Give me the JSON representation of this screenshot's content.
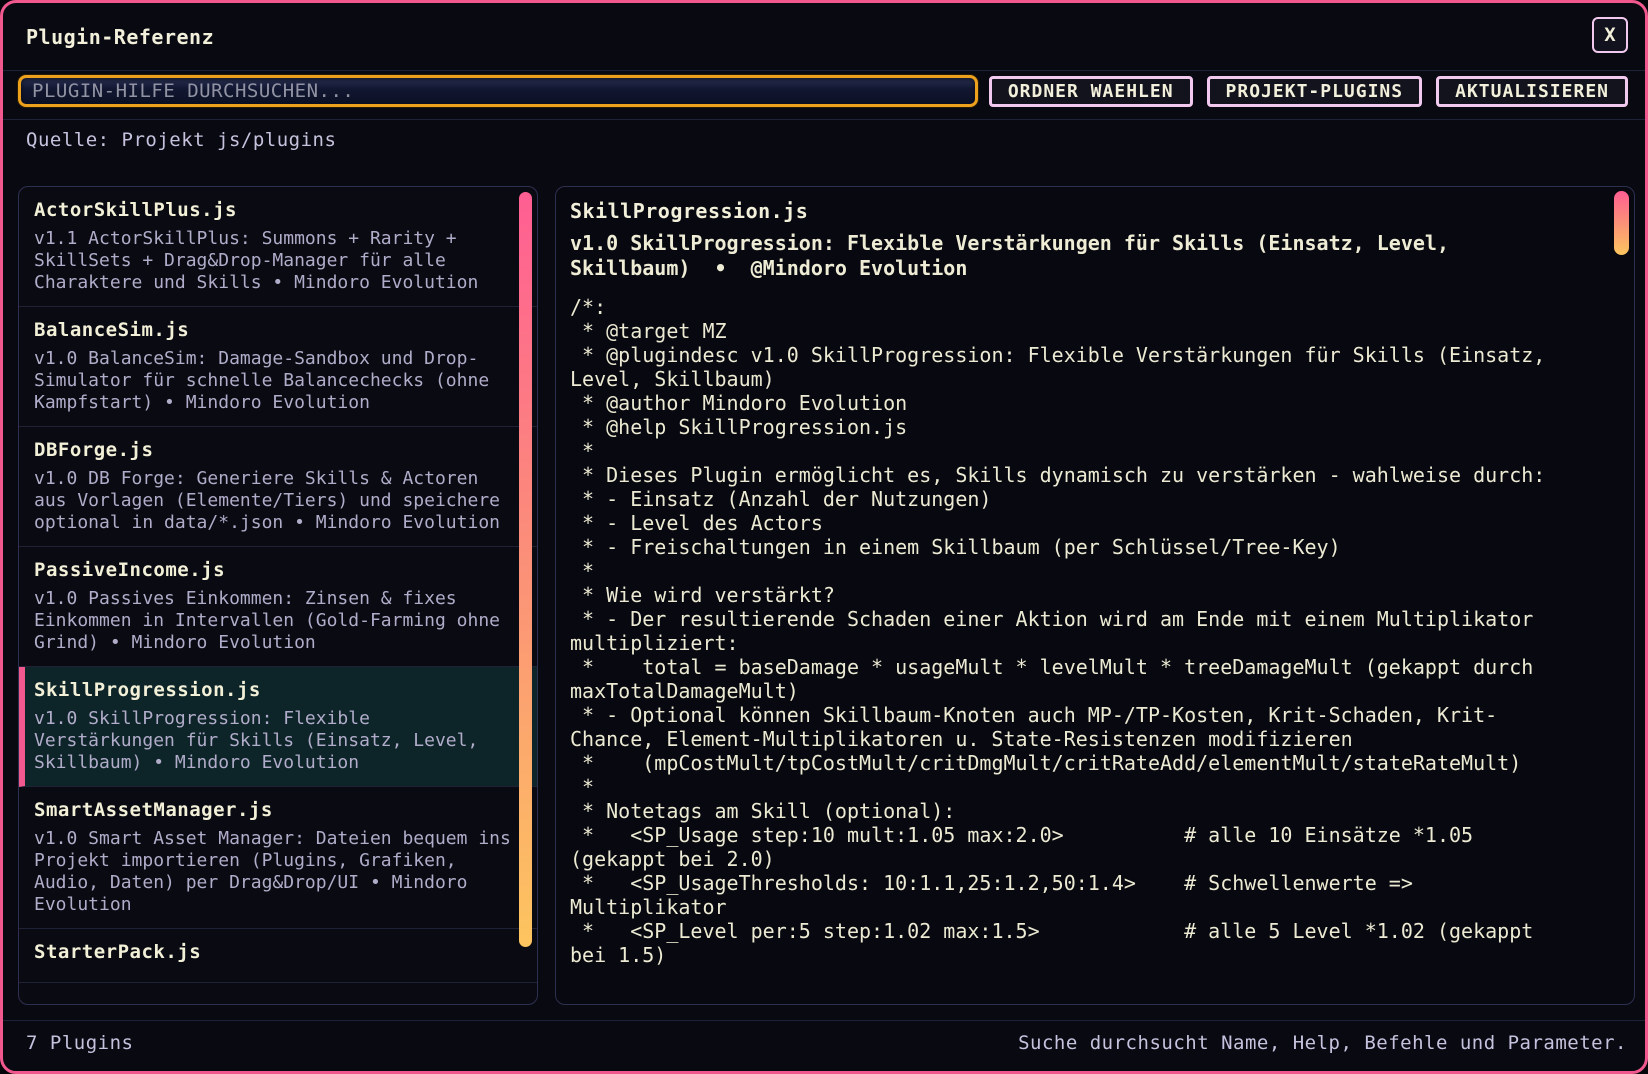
{
  "window": {
    "title": "Plugin-Referenz",
    "close_label": "X"
  },
  "toolbar": {
    "search_placeholder": "PLUGIN-HILFE DURCHSUCHEN...",
    "buttons": [
      "ORDNER WAEHLEN",
      "PROJEKT-PLUGINS",
      "AKTUALISIEREN"
    ]
  },
  "source_line": "Quelle: Projekt js/plugins",
  "plugin_list": [
    {
      "name": "ActorSkillPlus.js",
      "desc": "v1.1 ActorSkillPlus: Summons + Rarity + SkillSets + Drag&Drop-Manager für alle Charaktere und Skills • Mindoro Evolution",
      "selected": false
    },
    {
      "name": "BalanceSim.js",
      "desc": "v1.0 BalanceSim: Damage-Sandbox und Drop-Simulator für schnelle Balancechecks (ohne Kampfstart) • Mindoro Evolution",
      "selected": false
    },
    {
      "name": "DBForge.js",
      "desc": "v1.0 DB Forge: Generiere Skills & Actoren aus Vorlagen (Elemente/Tiers) und speichere optional in data/*.json • Mindoro Evolution",
      "selected": false
    },
    {
      "name": "PassiveIncome.js",
      "desc": "v1.0 Passives Einkommen: Zinsen & fixes Einkommen in Intervallen (Gold-Farming ohne Grind) • Mindoro Evolution",
      "selected": false
    },
    {
      "name": "SkillProgression.js",
      "desc": "v1.0 SkillProgression: Flexible Verstärkungen für Skills (Einsatz, Level, Skillbaum) • Mindoro Evolution",
      "selected": true
    },
    {
      "name": "SmartAssetManager.js",
      "desc": "v1.0 Smart Asset Manager: Dateien bequem ins Projekt importieren (Plugins, Grafiken, Audio, Daten) per Drag&Drop/UI • Mindoro Evolution",
      "selected": false
    },
    {
      "name": "StarterPack.js",
      "desc": "",
      "selected": false
    }
  ],
  "detail": {
    "title": "SkillProgression.js",
    "subtitle": "v1.0 SkillProgression: Flexible Verstärkungen für Skills (Einsatz, Level, Skillbaum)  •  @Mindoro Evolution",
    "help": "/*:\n * @target MZ\n * @plugindesc v1.0 SkillProgression: Flexible Verstärkungen für Skills (Einsatz, Level, Skillbaum)\n * @author Mindoro Evolution\n * @help SkillProgression.js\n *\n * Dieses Plugin ermöglicht es, Skills dynamisch zu verstärken - wahlweise durch:\n * - Einsatz (Anzahl der Nutzungen)\n * - Level des Actors\n * - Freischaltungen in einem Skillbaum (per Schlüssel/Tree-Key)\n *\n * Wie wird verstärkt?\n * - Der resultierende Schaden einer Aktion wird am Ende mit einem Multiplikator multipliziert:\n *    total = baseDamage * usageMult * levelMult * treeDamageMult (gekappt durch maxTotalDamageMult)\n * - Optional können Skillbaum-Knoten auch MP-/TP-Kosten, Krit-Schaden, Krit-Chance, Element-Multiplikatoren u. State-Resistenzen modifizieren\n *    (mpCostMult/tpCostMult/critDmgMult/critRateAdd/elementMult/stateRateMult)\n *\n * Notetags am Skill (optional):\n *   <SP_Usage step:10 mult:1.05 max:2.0>          # alle 10 Einsätze *1.05 (gekappt bei 2.0)\n *   <SP_UsageThresholds: 10:1.1,25:1.2,50:1.4>    # Schwellenwerte => Multiplikator\n *   <SP_Level per:5 step:1.02 max:1.5>            # alle 5 Level *1.02 (gekappt bei 1.5)"
  },
  "footer": {
    "left": "7 Plugins",
    "right": "Suche durchsucht Name, Help, Befehle und Parameter."
  },
  "colors": {
    "accent_pink": "#f0588e",
    "accent_amber": "#eda11d",
    "button_border": "#f2c9ee",
    "selected_bg": "#0d2429",
    "cream": "#f2efda",
    "lavender": "#c6c2de",
    "scrollbar_top": "#ff5e93",
    "scrollbar_mid": "#fb8f79",
    "scrollbar_bottom": "#fdc55f"
  }
}
